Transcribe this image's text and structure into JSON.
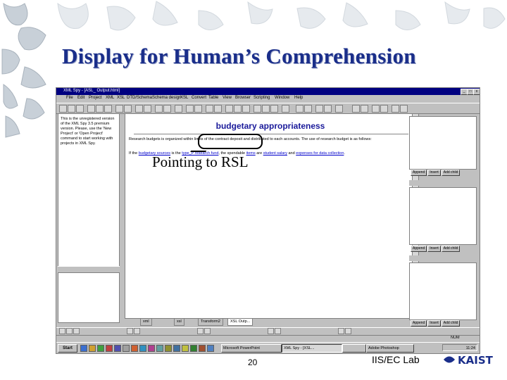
{
  "slide": {
    "title": "Display for Human’s Comprehension",
    "callout_text": "Pointing to RSL",
    "page_number": "20",
    "lab_label": "IIS/EC Lab",
    "logo_text": "KAIST"
  },
  "window": {
    "title": "XML Spy - [ASL_ Output.html]",
    "controls": {
      "minimize": "_",
      "maximize": "□",
      "close": "x"
    }
  },
  "menu": [
    "File",
    "Edit",
    "Project",
    "XML",
    "XSL",
    "DTD/Schema",
    "Schema design",
    "XSL",
    "Convert",
    "Table",
    "View",
    "Browser",
    "Scripting",
    "Window",
    "Help"
  ],
  "info_panel": {
    "text": "This is the unregistered version of the XML Spy 3.5 premium version. Please, use the 'New Project' or 'Open Project' command to start working with projects in XML Spy."
  },
  "document": {
    "heading": "budgetary appropriateness",
    "para1": "Research budgets is organized within limits of the contract deposit and distributed to each accounts. The use of research budget is as follows:",
    "para2": {
      "t1": "If the ",
      "link1": "budgetary sources",
      "t2": " is the ",
      "link2": "type_P research fund",
      "t3": ", the spendable ",
      "link3": "items",
      "t4": " are ",
      "link4": "student salary",
      "t5": " and ",
      "link5": "expenses for data collection",
      "t6": "."
    }
  },
  "right_panels": [
    {
      "buttons": [
        "Append",
        "Insert",
        "Add child"
      ]
    },
    {
      "buttons": [
        "Append",
        "Insert",
        "Add child"
      ]
    },
    {
      "buttons": [
        "Append",
        "Insert",
        "Add child"
      ]
    }
  ],
  "doc_tabs": [
    "xml",
    "xsl",
    "Transform2",
    "XSL Outp..."
  ],
  "taskbar": {
    "start": "Start",
    "tasks": [
      "Microsoft PowerPoint",
      "XML Spy - [XSL...",
      "",
      "Adobe Photoshop"
    ],
    "clock": "11:24"
  },
  "status": {
    "num": "NUM"
  },
  "colors": {
    "title_blue": "#1a2e8a",
    "titlebar": "#000080",
    "window_gray": "#c0c0c0",
    "link": "#0000cc"
  }
}
